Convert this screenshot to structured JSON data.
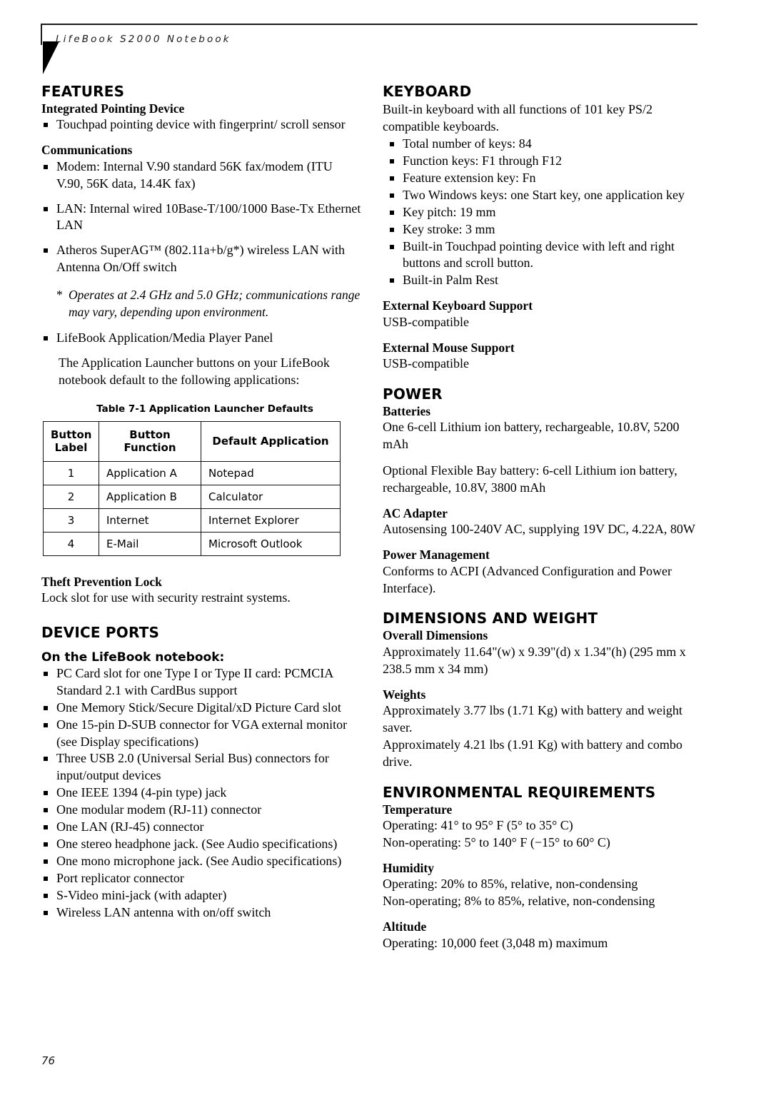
{
  "header": {
    "title": "LifeBook S2000 Notebook"
  },
  "page_number": "76",
  "left_column": {
    "features": {
      "heading": "FEATURES",
      "integrated_pointing_device": {
        "title": "Integrated Pointing Device",
        "bullets": [
          "Touchpad pointing device with fingerprint/ scroll sensor"
        ]
      },
      "communications": {
        "title": "Communications",
        "bullets": [
          "Modem: Internal V.90 standard 56K fax/modem (ITU V.90, 56K data, 14.4K fax)",
          "LAN: Internal wired 10Base-T/100/1000 Base-Tx Ethernet LAN",
          "Atheros SuperAG™ (802.11a+b/g*) wireless LAN with Antenna On/Off switch"
        ],
        "footnote_marker": "*",
        "footnote": "Operates at 2.4 GHz and 5.0 GHz; communications range may vary, depending upon environment.",
        "panel_bullet": "LifeBook Application/Media Player Panel",
        "panel_paragraph": "The Application Launcher buttons on your LifeBook notebook default to the following applications:"
      },
      "table": {
        "caption": "Table 7-1  Application Launcher Defaults",
        "headers": [
          "Button Label",
          "Button Function",
          "Default Application"
        ],
        "rows": [
          [
            "1",
            "Application A",
            "Notepad"
          ],
          [
            "2",
            "Application B",
            "Calculator"
          ],
          [
            "3",
            "Internet",
            "Internet Explorer"
          ],
          [
            "4",
            "E-Mail",
            "Microsoft Outlook"
          ]
        ]
      },
      "theft_prevention": {
        "title": "Theft Prevention Lock",
        "text": "Lock slot for use with security restraint systems."
      }
    },
    "device_ports": {
      "heading": "DEVICE PORTS",
      "subheading": "On the LifeBook notebook:",
      "bullets": [
        "PC Card slot for one Type I or Type II card: PCMCIA Standard 2.1 with CardBus support",
        "One Memory Stick/Secure Digital/xD Picture Card slot",
        "One 15-pin D-SUB connector for VGA external monitor (see Display specifications)",
        "Three USB 2.0 (Universal Serial Bus) connectors for input/output devices",
        "One IEEE 1394 (4-pin type) jack",
        "One modular modem (RJ-11) connector",
        "One LAN (RJ-45) connector",
        "One stereo headphone jack. (See Audio specifications)",
        "One mono microphone jack. (See Audio specifications)",
        "Port replicator connector",
        "S-Video mini-jack (with adapter)",
        "Wireless LAN antenna with on/off switch"
      ]
    }
  },
  "right_column": {
    "keyboard": {
      "heading": "KEYBOARD",
      "intro": "Built-in keyboard with all functions of 101 key PS/2 compatible keyboards.",
      "bullets": [
        "Total number of keys: 84",
        "Function keys: F1 through F12",
        "Feature extension key: Fn",
        "Two Windows keys: one Start key, one application key",
        "Key pitch: 19 mm",
        "Key stroke: 3 mm",
        "Built-in Touchpad pointing device with left and right buttons and scroll button.",
        "Built-in Palm Rest"
      ],
      "external_keyboard": {
        "title": "External Keyboard Support",
        "text": "USB-compatible"
      },
      "external_mouse": {
        "title": "External Mouse Support",
        "text": "USB-compatible"
      }
    },
    "power": {
      "heading": "POWER",
      "batteries": {
        "title": "Batteries",
        "text1": "One 6-cell Lithium ion battery, rechargeable, 10.8V, 5200 mAh",
        "text2": "Optional Flexible Bay battery: 6-cell Lithium ion battery, rechargeable, 10.8V, 3800 mAh"
      },
      "ac_adapter": {
        "title": "AC Adapter",
        "text": "Autosensing 100-240V AC, supplying 19V DC, 4.22A, 80W"
      },
      "power_management": {
        "title": "Power Management",
        "text": "Conforms to ACPI (Advanced Configuration and Power Interface)."
      }
    },
    "dimensions": {
      "heading": "DIMENSIONS AND WEIGHT",
      "overall": {
        "title": "Overall Dimensions",
        "text": "Approximately 11.64\"(w) x 9.39\"(d) x 1.34\"(h) (295 mm x 238.5 mm x 34 mm)"
      },
      "weights": {
        "title": "Weights",
        "text1": "Approximately 3.77 lbs (1.71 Kg) with battery and weight saver.",
        "text2": "Approximately 4.21 lbs (1.91 Kg) with battery and combo drive."
      }
    },
    "environmental": {
      "heading": "ENVIRONMENTAL REQUIREMENTS",
      "temperature": {
        "title": "Temperature",
        "line1": "Operating: 41° to 95° F (5° to 35° C)",
        "line2": "Non-operating: 5° to 140° F (−15° to 60° C)"
      },
      "humidity": {
        "title": "Humidity",
        "line1": "Operating: 20% to 85%, relative, non-condensing",
        "line2": "Non-operating; 8% to 85%, relative, non-condensing"
      },
      "altitude": {
        "title": "Altitude",
        "line1": "Operating: 10,000 feet (3,048 m) maximum"
      }
    }
  }
}
